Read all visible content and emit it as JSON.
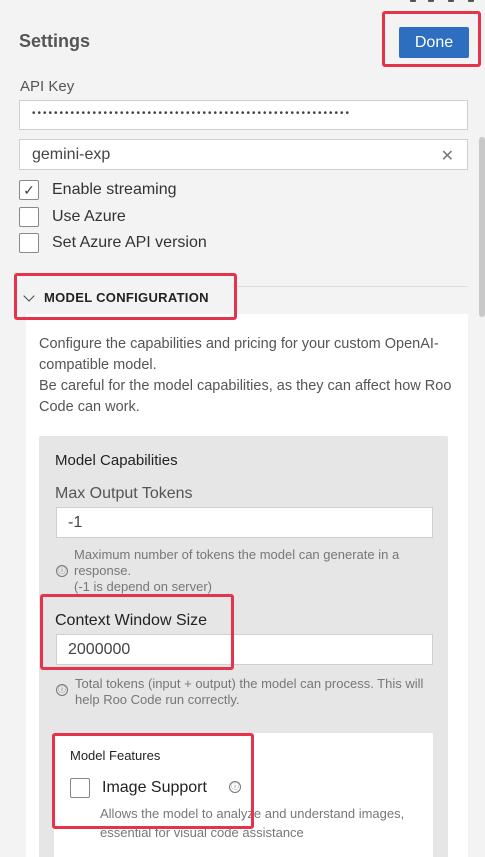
{
  "header": {
    "title": "Settings",
    "done_label": "Done"
  },
  "api_key": {
    "label": "API Key",
    "masked_value": "••••••••••••••••••••••••••••••••••••••••••••••••••••••••••"
  },
  "model_id": {
    "value": "gemini-exp",
    "clear_glyph": "✕"
  },
  "options": [
    {
      "label": "Enable streaming",
      "checked": true
    },
    {
      "label": "Use Azure",
      "checked": false
    },
    {
      "label": "Set Azure API version",
      "checked": false
    }
  ],
  "model_configuration": {
    "section_title": "MODEL CONFIGURATION",
    "description_line1": "Configure the capabilities and pricing for your custom OpenAI-compatible model.",
    "description_line2": "Be careful for the model capabilities, as they can affect how Roo Code can work.",
    "capabilities": {
      "title": "Model Capabilities",
      "max_output_tokens": {
        "label": "Max Output Tokens",
        "value": "-1",
        "help_line1": "Maximum number of tokens the model can generate in a response.",
        "help_line2": "(-1 is depend on server)"
      },
      "context_window": {
        "label": "Context Window Size",
        "value": "2000000",
        "help": "Total tokens (input + output) the model can process. This will help Roo Code run correctly."
      },
      "features": {
        "title": "Model Features",
        "image_support": {
          "label": "Image Support",
          "checked": false,
          "help": "Allows the model to analyze and understand images, essential for visual code assistance"
        }
      }
    }
  },
  "colors": {
    "accent": "#2d6ec1",
    "highlight": "#e5334b",
    "background": "#f3f3f3"
  },
  "icons": {
    "info": "ⓘ",
    "check": "✓"
  }
}
